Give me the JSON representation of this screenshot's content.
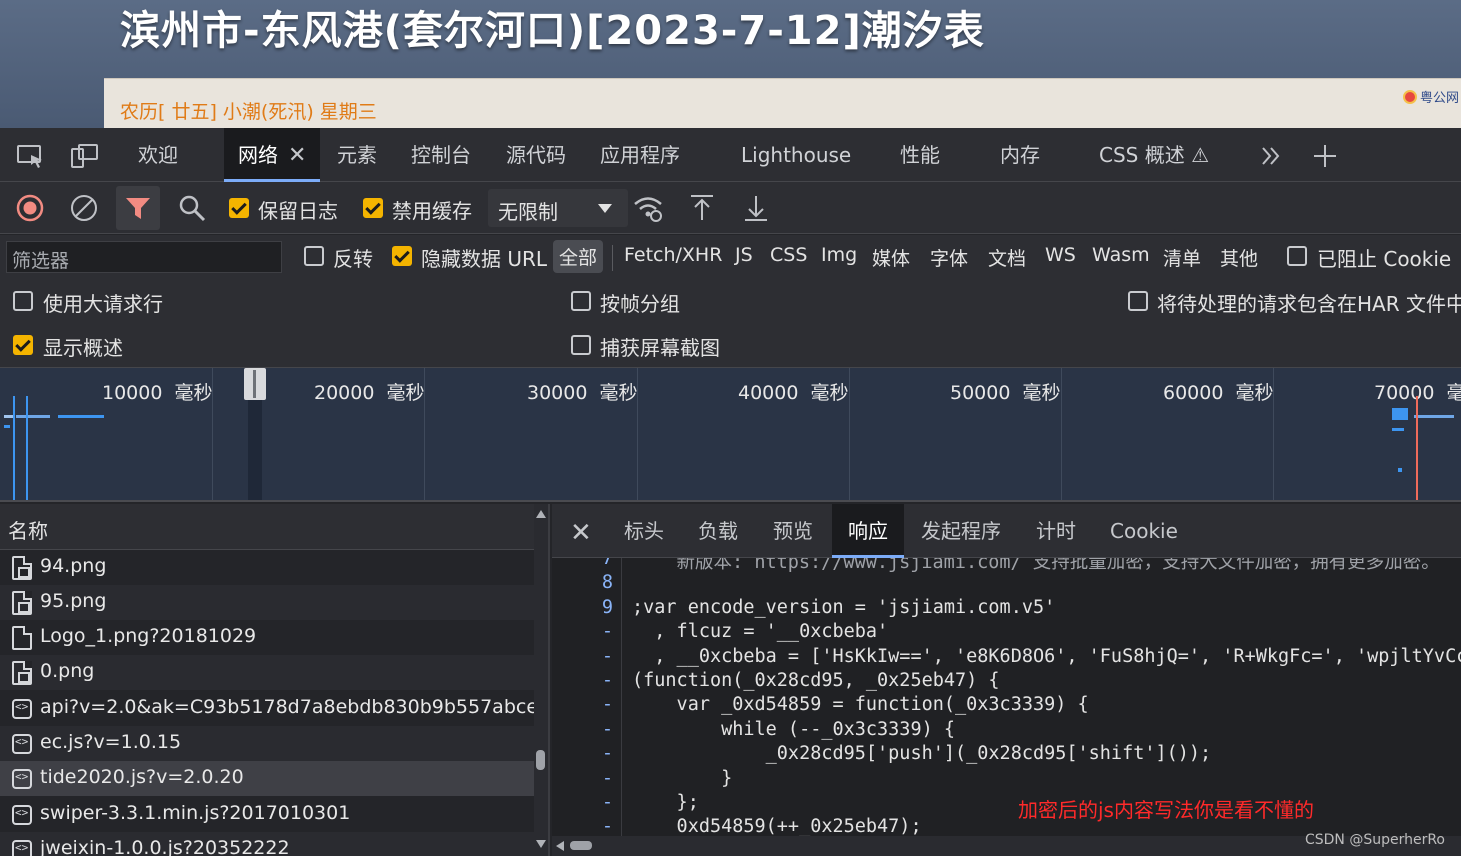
{
  "page": {
    "title": "滨州市-东风港(套尔河口)[2023-7-12]潮汐表",
    "subtitle": "农历[ 廿五] 小潮(死汛) 星期三",
    "corner_text": "粤公网"
  },
  "devtools": {
    "tabs": [
      "欢迎",
      "网络",
      "元素",
      "控制台",
      "源代码",
      "应用程序",
      "Lighthouse",
      "性能",
      "内存",
      "CSS 概述 ⚠"
    ],
    "active_tab": "网络",
    "toolbar": {
      "preserve_log": "保留日志",
      "disable_cache": "禁用缓存",
      "throttling": "无限制"
    },
    "filter": {
      "placeholder": "筛选器",
      "invert": "反转",
      "hide_data_urls": "隐藏数据 URL",
      "types": [
        "全部",
        "Fetch/XHR",
        "JS",
        "CSS",
        "Img",
        "媒体",
        "字体",
        "文档",
        "WS",
        "Wasm",
        "清单",
        "其他"
      ],
      "selected_type": "全部",
      "blocked_cookies": "已阻止 Cookie"
    },
    "options": {
      "big_request_rows": "使用大请求行",
      "group_by_frame": "按帧分组",
      "har_pending": "将待处理的请求包含在HAR 文件中",
      "show_overview": "显示概述",
      "capture_screenshots": "捕获屏幕截图"
    },
    "overview": {
      "unit": "毫秒",
      "ticks": [
        "10000",
        "20000",
        "30000",
        "40000",
        "50000",
        "60000",
        "70000"
      ],
      "last_unit": "毫"
    },
    "requests": {
      "header": "名称",
      "rows": [
        {
          "name": "94.png",
          "icon": "image-file-icon"
        },
        {
          "name": "95.png",
          "icon": "image-file-icon"
        },
        {
          "name": "Logo_1.png?20181029",
          "icon": "document-file-icon"
        },
        {
          "name": "0.png",
          "icon": "image-file-icon"
        },
        {
          "name": "api?v=2.0&ak=C93b5178d7a8ebdb830b9b557abce...",
          "icon": "script-file-icon"
        },
        {
          "name": "ec.js?v=1.0.15",
          "icon": "script-file-icon"
        },
        {
          "name": "tide2020.js?v=2.0.20",
          "icon": "script-file-icon",
          "selected": true
        },
        {
          "name": "swiper-3.3.1.min.js?2017010301",
          "icon": "script-file-icon"
        },
        {
          "name": "jweixin-1.0.0.js?20352222",
          "icon": "script-file-icon"
        }
      ]
    },
    "detail_tabs": [
      "标头",
      "负载",
      "预览",
      "响应",
      "发起程序",
      "计时",
      "Cookie"
    ],
    "active_detail_tab": "响应",
    "code": {
      "line_numbers": [
        "7",
        "8",
        "9",
        "-",
        "-",
        "-",
        "-",
        "-",
        "-",
        "-",
        "-",
        "-"
      ],
      "lines": [
        "    新版本: https://www.jsjiami.com/ 支持批量加密，支持大文件加密，拥有更多加密。",
        "",
        ";var encode_version = 'jsjiami.com.v5'",
        "  , flcuz = '__0xcbeba'",
        "  , __0xcbeba = ['HsKkIw==', 'e8K6D8O6', 'FuS8hjQ=', 'R+WkgFc=', 'wpjltYvCc",
        "(function(_0x28cd95, _0x25eb47) {",
        "    var _0xd54859 = function(_0x3c3339) {",
        "        while (--_0x3c3339) {",
        "            _0x28cd95['push'](_0x28cd95['shift']());",
        "        }",
        "    };",
        "    0xd54859(++_0x25eb47);"
      ],
      "annotation": "加密后的js内容写法你是看不懂的"
    },
    "watermark": "CSDN @SuperherRo"
  },
  "colors": {
    "accent": "#7cacf8",
    "checkbox": "#f4b400",
    "record": "#f28b82",
    "annotation": "#ff2a2a"
  }
}
